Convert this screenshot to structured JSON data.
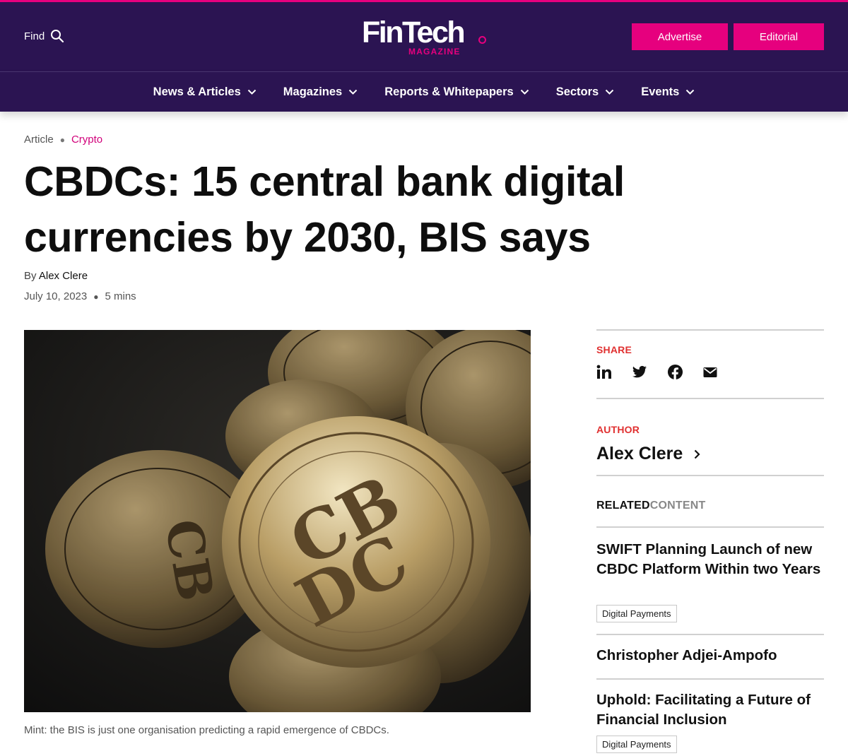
{
  "header": {
    "find_label": "Find",
    "logo_word": "FinTech",
    "logo_sub": "MAGAZINE",
    "advertise_label": "Advertise",
    "editorial_label": "Editorial",
    "brand_color": "#2b1452",
    "accent_color": "#e6007e"
  },
  "nav": {
    "items": [
      {
        "label": "News & Articles",
        "icon": "chevron-down-icon"
      },
      {
        "label": "Magazines",
        "icon": "chevron-down-icon"
      },
      {
        "label": "Reports & Whitepapers",
        "icon": "chevron-down-icon"
      },
      {
        "label": "Sectors",
        "icon": "chevron-down-icon"
      },
      {
        "label": "Events",
        "icon": "chevron-down-icon"
      }
    ]
  },
  "article": {
    "breadcrumb_type": "Article",
    "breadcrumb_category": "Crypto",
    "title": "CBDCs: 15 central bank digital currencies by 2030, BIS says",
    "by_prefix": "By",
    "author": "Alex Clere",
    "date": "July 10, 2023",
    "read_time": "5 mins",
    "caption": "Mint: the BIS is just one organisation predicting a rapid emergence of CBDCs."
  },
  "sidebar": {
    "share_label": "SHARE",
    "share_icons": [
      "linkedin-icon",
      "twitter-icon",
      "facebook-icon",
      "email-icon"
    ],
    "author_label": "AUTHOR",
    "author_name": "Alex Clere",
    "related_a": "RELATED",
    "related_b": "CONTENT",
    "related_items": [
      {
        "title": "SWIFT Planning Launch of new CBDC Platform Within two Years",
        "tag": "Digital Payments"
      },
      {
        "title": "Christopher Adjei-Ampofo",
        "tag": ""
      },
      {
        "title": "Uphold: Facilitating a Future of Financial Inclusion",
        "tag": "Digital Payments"
      }
    ]
  }
}
